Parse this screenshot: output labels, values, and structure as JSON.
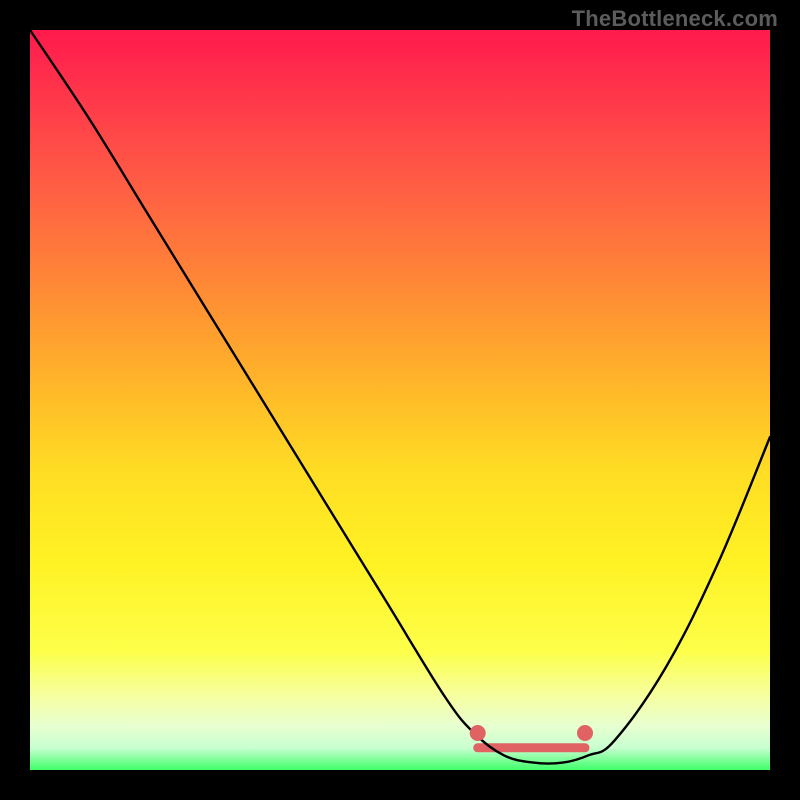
{
  "watermark": "TheBottleneck.com",
  "chart_data": {
    "type": "line",
    "title": "",
    "xlabel": "",
    "ylabel": "",
    "xlim": [
      0,
      100
    ],
    "ylim": [
      0,
      100
    ],
    "grid": false,
    "series": [
      {
        "name": "bottleneck-curve",
        "x": [
          0,
          8,
          16,
          24,
          32,
          40,
          48,
          56,
          60,
          64,
          68,
          72,
          75.5,
          79,
          86,
          93,
          100
        ],
        "values": [
          100,
          88,
          75,
          62,
          49,
          36,
          23,
          10,
          5,
          2,
          1,
          1,
          2,
          4,
          14,
          28,
          45
        ],
        "color": "#000000"
      }
    ],
    "markers": [
      {
        "name": "trough-start",
        "x": 60.5,
        "y": 5.0,
        "color": "#e06262",
        "r": 8
      },
      {
        "name": "trough-end",
        "x": 75.0,
        "y": 5.0,
        "color": "#e06262",
        "r": 8
      }
    ],
    "bands": [
      {
        "name": "trough-band",
        "x0": 60.5,
        "x1": 75.0,
        "y": 3.0,
        "color": "#e06262",
        "thickness": 9
      }
    ]
  }
}
